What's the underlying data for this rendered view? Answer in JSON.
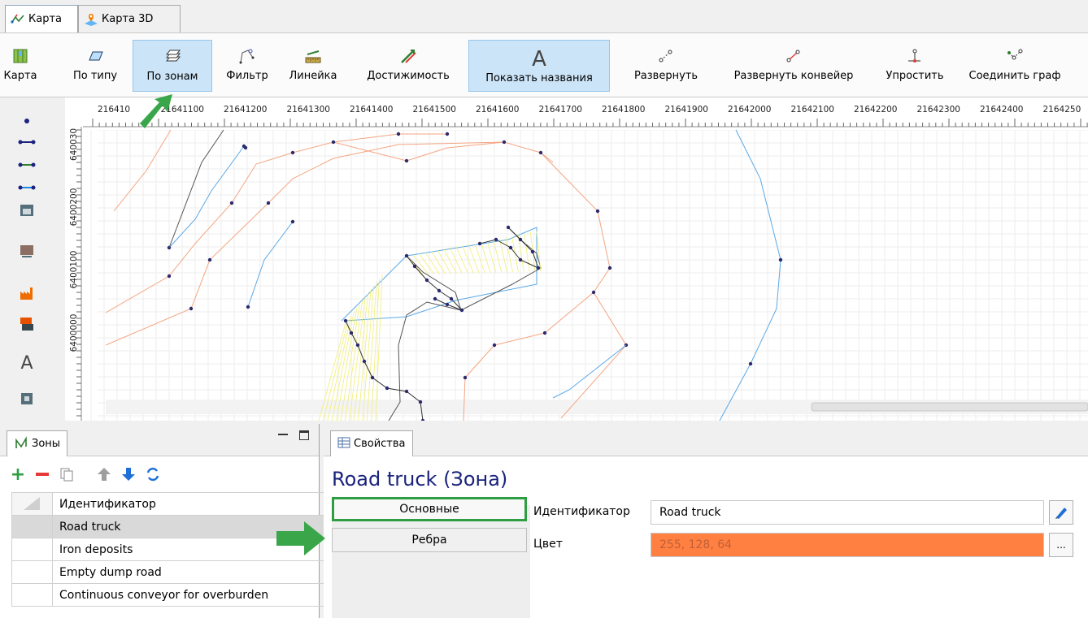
{
  "tabs": [
    {
      "label": "Карта",
      "icon": "map-route-icon",
      "active": true
    },
    {
      "label": "Карта 3D",
      "icon": "map-3d-icon",
      "active": false
    }
  ],
  "toolbar": {
    "map": "Карта",
    "by_type": "По типу",
    "by_zones": "По зонам",
    "filter": "Фильтр",
    "ruler": "Линейка",
    "reach": "Достижимость",
    "show_names": "Показать названия",
    "expand": "Развернуть",
    "expand_conveyor": "Развернуть конвейер",
    "simplify": "Упростить",
    "connect_graph": "Соединить граф"
  },
  "map": {
    "x_ticks": [
      "216410",
      "21641100",
      "21641200",
      "21641300",
      "21641400",
      "21641500",
      "21641600",
      "21641700",
      "21641800",
      "21641900",
      "21642000",
      "21642100",
      "21642200",
      "21642300",
      "21642400",
      "2164250"
    ],
    "y_ticks": [
      "640030",
      "6400200",
      "6400100",
      "6400000"
    ],
    "colors": {
      "contour": "#f4a582",
      "blue": "#5aa8e6",
      "zone": "#444444",
      "yellow": "#f2ee76",
      "point": "#2b2a6e"
    }
  },
  "leftbar": {
    "icons": [
      "point-icon",
      "line-icon",
      "green-arrow-line-icon",
      "blue-arrow-line-icon",
      "storage-icon",
      "monitor-icon",
      "factory-icon",
      "unload-icon",
      "text-icon",
      "machine-icon"
    ],
    "text_glyph": "A"
  },
  "zones": {
    "tab_label": "Зоны",
    "header": "Идентификатор",
    "rows": [
      "Road truck",
      "Iron deposits",
      "Empty dump road",
      "Continuous conveyor for overburden"
    ],
    "selected_index": 0
  },
  "properties": {
    "tab_label": "Свойства",
    "title": "Road truck (Зона)",
    "sections": [
      "Основные",
      "Ребра"
    ],
    "id_label": "Идентификатор",
    "id_value": "Road truck",
    "color_label": "Цвет",
    "color_value": "255, 128, 64",
    "color_hex": "#ff8040",
    "more_button": "..."
  }
}
